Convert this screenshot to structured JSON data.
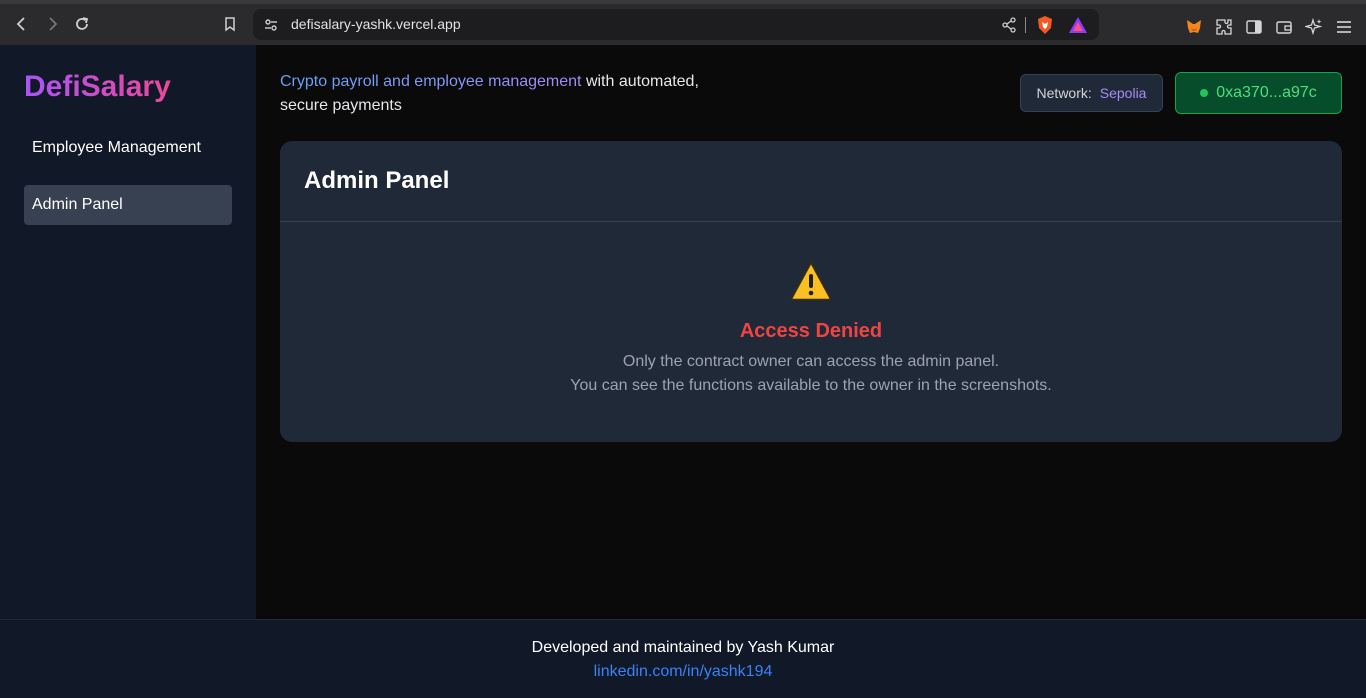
{
  "browser": {
    "url": "defisalary-yashk.vercel.app"
  },
  "sidebar": {
    "brand": "DefiSalary",
    "items": [
      {
        "label": "Employee Management"
      },
      {
        "label": "Admin Panel"
      }
    ]
  },
  "header": {
    "tagline_highlight": "Crypto payroll and employee management",
    "tagline_rest": " with automated, secure payments",
    "network_label": "Network:",
    "network_value": "Sepolia",
    "wallet": "0xa370...a97c"
  },
  "admin_card": {
    "title": "Admin Panel",
    "status": "Access Denied",
    "message_line1": "Only the contract owner can access the admin panel.",
    "message_line2": "You can see the functions available to the owner in the screenshots."
  },
  "footer": {
    "credit": "Developed and maintained by Yash Kumar",
    "link": "linkedin.com/in/yashk194"
  },
  "colors": {
    "accent_purple": "#a855f7",
    "accent_pink": "#ec4899",
    "danger": "#ef4444",
    "wallet_green": "#4ade80",
    "link_blue": "#3b82f6"
  }
}
